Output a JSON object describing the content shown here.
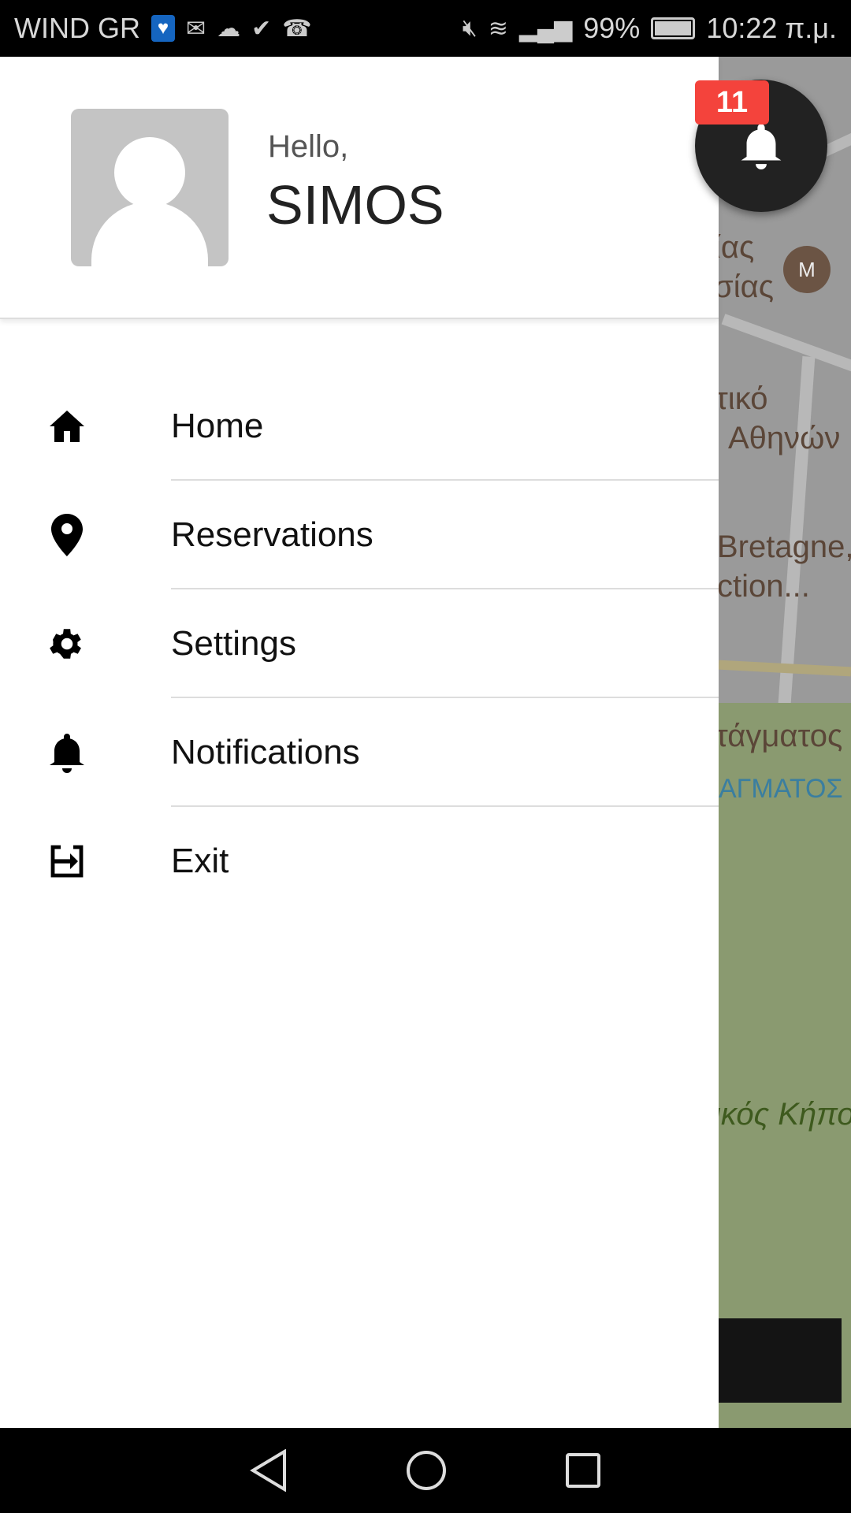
{
  "status_bar": {
    "carrier": "WIND GR",
    "battery": "99%",
    "time": "10:22 π.μ.",
    "icons": [
      "health-app-icon",
      "gmail-icon",
      "cloud-icon",
      "check-icon",
      "missed-call-icon",
      "mute-icon",
      "wifi-icon",
      "signal-icon",
      "battery-icon"
    ]
  },
  "header": {
    "greeting": "Hello,",
    "username": "SIMOS"
  },
  "menu": {
    "items": [
      {
        "label": "Home",
        "icon": "home-icon"
      },
      {
        "label": "Reservations",
        "icon": "location-pin-icon"
      },
      {
        "label": "Settings",
        "icon": "gear-icon"
      },
      {
        "label": "Notifications",
        "icon": "bell-icon"
      },
      {
        "label": "Exit",
        "icon": "exit-icon"
      }
    ]
  },
  "notifications": {
    "count": "11",
    "badge_color": "#f4433c"
  },
  "map": {
    "labels": [
      "ίας",
      "σίας",
      "τικό",
      "Αθηνών",
      "Bretagne,",
      "ction...",
      "τάγματος",
      "ΑΓΜΑΤΟΣ",
      "ικός Κήπο"
    ]
  }
}
